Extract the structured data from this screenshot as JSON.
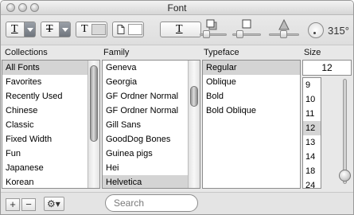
{
  "window": {
    "title": "Font"
  },
  "toolbar": {
    "underline_glyph": "T",
    "strike_glyph": "T",
    "text_color_glyph": "T",
    "bg_icon": "document-color-icon",
    "shadow_glyph": "T",
    "rotation": "315°"
  },
  "columns": {
    "collections": {
      "header": "Collections",
      "items": [
        "All Fonts",
        "Favorites",
        "Recently Used",
        "Chinese",
        "Classic",
        "Fixed Width",
        "Fun",
        "Japanese",
        "Korean"
      ],
      "selected_index": 0
    },
    "family": {
      "header": "Family",
      "items": [
        "Geneva",
        "Georgia",
        "GF Ordner Normal",
        "GF Ordner Normal",
        "Gill Sans",
        "GoodDog Bones",
        "Guinea pigs",
        "Hei",
        "Helvetica"
      ],
      "selected_index": 8
    },
    "typeface": {
      "header": "Typeface",
      "items": [
        "Regular",
        "Oblique",
        "Bold",
        "Bold Oblique"
      ],
      "selected_index": 0
    },
    "size": {
      "header": "Size",
      "value": "12",
      "items": [
        "9",
        "10",
        "11",
        "12",
        "13",
        "14",
        "18",
        "24"
      ],
      "selected_index": 3
    }
  },
  "bottom": {
    "add_label": "+",
    "remove_label": "−",
    "action_label": "⚙▾",
    "search_placeholder": "Search"
  },
  "colors": {
    "selection": "#d4d4d4",
    "chrome": "#e8e8e8"
  }
}
